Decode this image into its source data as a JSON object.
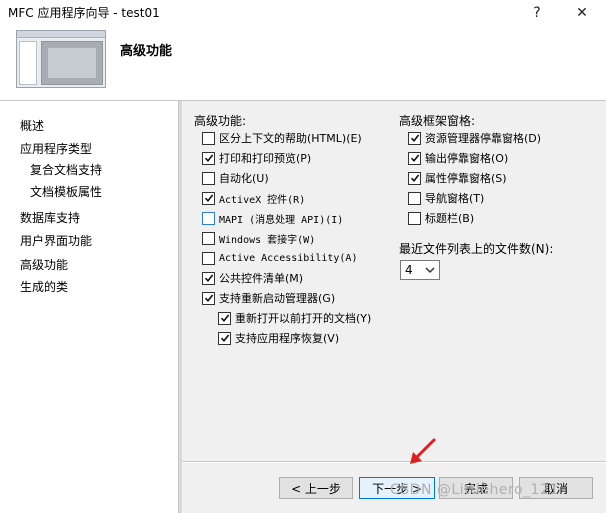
{
  "window": {
    "title": "MFC 应用程序向导 - test01",
    "help_glyph": "?",
    "close_glyph": "✕"
  },
  "header": {
    "title": "高级功能"
  },
  "nav": {
    "items": [
      {
        "label": "概述"
      },
      {
        "label": "应用程序类型"
      },
      {
        "label": "复合文档支持"
      },
      {
        "label": "文档模板属性"
      },
      {
        "label": "数据库支持"
      },
      {
        "label": "用户界面功能"
      },
      {
        "label": "高级功能"
      },
      {
        "label": "生成的类"
      }
    ],
    "selected": "高级功能"
  },
  "advanced": {
    "group_label": "高级功能:",
    "options": [
      {
        "label": "区分上下文的帮助(HTML)(E)",
        "checked": false
      },
      {
        "label": "打印和打印预览(P)",
        "checked": true
      },
      {
        "label": "自动化(U)",
        "checked": false
      },
      {
        "label": "ActiveX 控件(R)",
        "checked": true
      },
      {
        "label": "MAPI (消息处理 API)(I)",
        "checked": false
      },
      {
        "label": "Windows 套接字(W)",
        "checked": false
      },
      {
        "label": "Active Accessibility(A)",
        "checked": false
      },
      {
        "label": "公共控件清单(M)",
        "checked": true
      },
      {
        "label": "支持重新启动管理器(G)",
        "checked": true
      },
      {
        "label": "重新打开以前打开的文档(Y)",
        "checked": true
      },
      {
        "label": "支持应用程序恢复(V)",
        "checked": true
      }
    ]
  },
  "frame": {
    "group_label": "高级框架窗格:",
    "options": [
      {
        "label": "资源管理器停靠窗格(D)",
        "checked": true
      },
      {
        "label": "输出停靠窗格(O)",
        "checked": true
      },
      {
        "label": "属性停靠窗格(S)",
        "checked": true
      },
      {
        "label": "导航窗格(T)",
        "checked": false
      },
      {
        "label": "标题栏(B)",
        "checked": false
      }
    ]
  },
  "mru": {
    "label": "最近文件列表上的文件数(N):",
    "value": "4"
  },
  "buttons": {
    "prev": "< 上一步",
    "next": "下一步 >",
    "finish": "完成",
    "cancel": "取消"
  },
  "watermark": "CSDN @Littlehero_121",
  "colors": {
    "accent": "#0078d7",
    "arrow": "#e02020"
  }
}
